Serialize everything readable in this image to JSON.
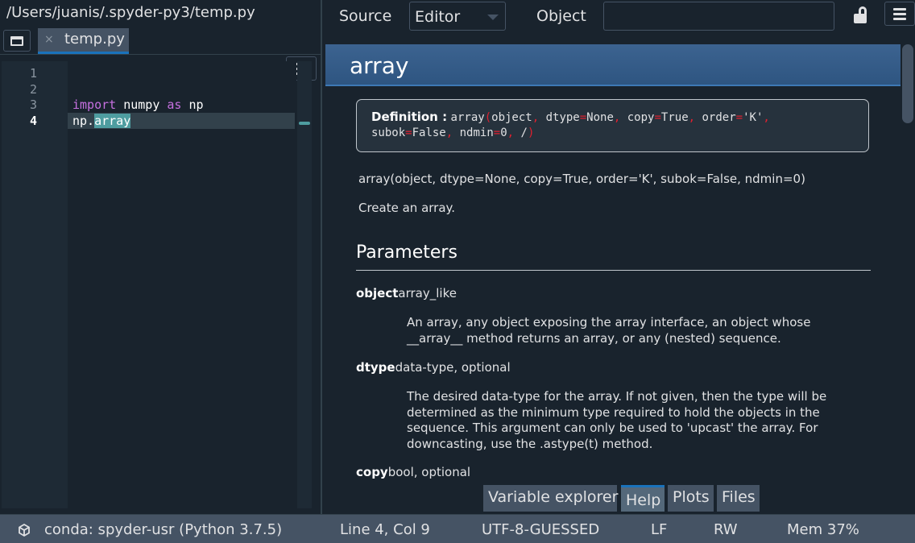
{
  "editor": {
    "path_title": "/Users/juanis/.spyder-py3/temp.py",
    "tab_close": "×",
    "tab_label": "temp.py",
    "line_numbers": [
      "1",
      "2",
      "3",
      "4"
    ],
    "code": {
      "line3_kw1": "import",
      "line3_mod": " numpy ",
      "line3_kw2": "as",
      "line3_alias": " np",
      "line4_prefix": "np.",
      "line4_selected": "array"
    }
  },
  "help": {
    "source_label": "Source",
    "source_value": "Editor",
    "object_label": "Object",
    "object_value": "",
    "title": "array",
    "definition_label": "Definition :",
    "signature": {
      "name": "array",
      "p1": "object",
      "p2": " dtype",
      "v2": "None",
      "p3": " copy",
      "v3": "True",
      "p4": " order",
      "v4": "'K'",
      "p5": "subok",
      "v5": "False",
      "p6": " ndmin",
      "v6": "0",
      "p7": " /"
    },
    "call_signature": "array(object, dtype=None, copy=True, order='K', subok=False, ndmin=0)",
    "summary": "Create an array.",
    "parameters_heading": "Parameters",
    "params": [
      {
        "name": "object",
        "type": "array_like",
        "desc": "An array, any object exposing the array interface, an object whose __array__ method returns an array, or any (nested) sequence."
      },
      {
        "name": "dtype",
        "type": "data-type, optional",
        "desc": "The desired data-type for the array. If not given, then the type will be determined as the minimum type required to hold the objects in the sequence. This argument can only be used to 'upcast' the array. For downcasting, use the .astype(t) method."
      },
      {
        "name": "copy",
        "type": "bool, optional",
        "desc": ""
      }
    ],
    "bottom_tabs": [
      "Variable explorer",
      "Help",
      "Plots",
      "Files"
    ],
    "active_tab": "Help"
  },
  "statusbar": {
    "conda": "conda: spyder-usr (Python 3.7.5)",
    "position": "Line 4, Col 9",
    "encoding": "UTF-8-GUESSED",
    "eol": "LF",
    "permissions": "RW",
    "memory": "Mem 37%"
  },
  "colors": {
    "background": "#19232d",
    "accent": "#1a72bb",
    "keyword": "#c670e0",
    "selection": "#4e9da0",
    "signature_red": "#e0202f"
  }
}
